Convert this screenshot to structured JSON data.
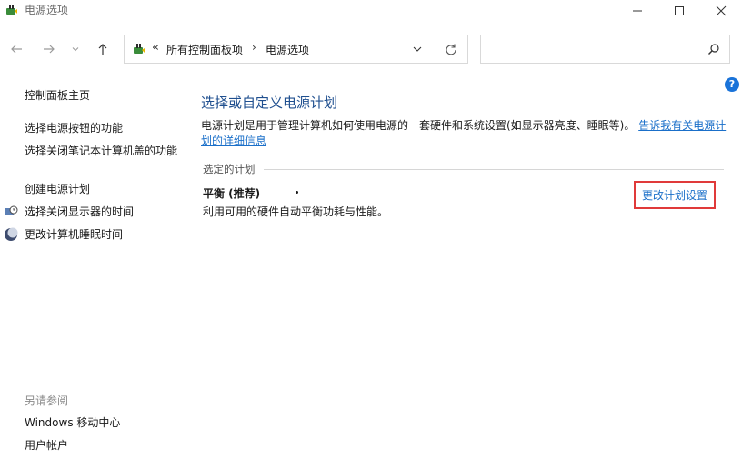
{
  "window": {
    "title": "电源选项"
  },
  "address": {
    "chevron": "«",
    "segment1": "所有控制面板项",
    "separator": "›",
    "segment2": "电源选项"
  },
  "search": {
    "placeholder": ""
  },
  "help": {
    "glyph": "?"
  },
  "sidebar": {
    "home": "控制面板主页",
    "items": [
      "选择电源按钮的功能",
      "选择关闭笔记本计算机盖的功能",
      "创建电源计划",
      "选择关闭显示器的时间",
      "更改计算机睡眠时间"
    ],
    "see_also_label": "另请参阅",
    "see_also": [
      "Windows 移动中心",
      "用户帐户"
    ]
  },
  "main": {
    "title": "选择或自定义电源计划",
    "description": "电源计划是用于管理计算机如何使用电源的一套硬件和系统设置(如显示器亮度、睡眠等)。",
    "more_link": "告诉我有关电源计划的详细信息",
    "section_label": "选定的计划",
    "plan": {
      "name": "平衡 (推荐)",
      "description": "利用可用的硬件自动平衡功耗与性能。",
      "change_link": "更改计划设置"
    }
  },
  "colors": {
    "link": "#1a6fc9",
    "title": "#1f4f8f",
    "highlight_border": "#e03a3a",
    "help": "#1a73d9"
  },
  "icons": [
    "power-options-icon",
    "minimize-icon",
    "maximize-icon",
    "close-icon",
    "back-arrow-icon",
    "forward-arrow-icon",
    "chevron-down-icon",
    "up-arrow-icon",
    "refresh-icon",
    "search-icon",
    "help-icon",
    "display-icon",
    "sleep-moon-icon"
  ]
}
